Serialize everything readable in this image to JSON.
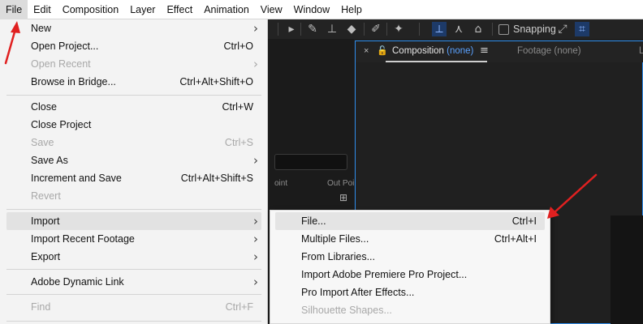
{
  "menubar": {
    "items": [
      "File",
      "Edit",
      "Composition",
      "Layer",
      "Effect",
      "Animation",
      "View",
      "Window",
      "Help"
    ]
  },
  "file_menu": {
    "items": [
      {
        "label": "New",
        "shortcut": "",
        "submenu": true,
        "disabled": false
      },
      {
        "label": "Open Project...",
        "shortcut": "Ctrl+O",
        "submenu": false,
        "disabled": false
      },
      {
        "label": "Open Recent",
        "shortcut": "",
        "submenu": true,
        "disabled": true
      },
      {
        "label": "Browse in Bridge...",
        "shortcut": "Ctrl+Alt+Shift+O",
        "submenu": false,
        "disabled": false
      },
      {
        "label": "Close",
        "shortcut": "Ctrl+W",
        "submenu": false,
        "disabled": false
      },
      {
        "label": "Close Project",
        "shortcut": "",
        "submenu": false,
        "disabled": false
      },
      {
        "label": "Save",
        "shortcut": "Ctrl+S",
        "submenu": false,
        "disabled": true
      },
      {
        "label": "Save As",
        "shortcut": "",
        "submenu": true,
        "disabled": false
      },
      {
        "label": "Increment and Save",
        "shortcut": "Ctrl+Alt+Shift+S",
        "submenu": false,
        "disabled": false
      },
      {
        "label": "Revert",
        "shortcut": "",
        "submenu": false,
        "disabled": true
      },
      {
        "label": "Import",
        "shortcut": "",
        "submenu": true,
        "disabled": false
      },
      {
        "label": "Import Recent Footage",
        "shortcut": "",
        "submenu": true,
        "disabled": false
      },
      {
        "label": "Export",
        "shortcut": "",
        "submenu": true,
        "disabled": false
      },
      {
        "label": "Adobe Dynamic Link",
        "shortcut": "",
        "submenu": true,
        "disabled": false
      },
      {
        "label": "Find",
        "shortcut": "Ctrl+F",
        "submenu": false,
        "disabled": true
      }
    ]
  },
  "import_submenu": {
    "items": [
      {
        "label": "File...",
        "shortcut": "Ctrl+I",
        "disabled": false
      },
      {
        "label": "Multiple Files...",
        "shortcut": "Ctrl+Alt+I",
        "disabled": false
      },
      {
        "label": "From Libraries...",
        "shortcut": "",
        "disabled": false
      },
      {
        "label": "Import Adobe Premiere Pro Project...",
        "shortcut": "",
        "disabled": false
      },
      {
        "label": "Pro Import After Effects...",
        "shortcut": "",
        "disabled": false
      },
      {
        "label": "Silhouette Shapes...",
        "shortcut": "",
        "disabled": true
      }
    ]
  },
  "toolbar": {
    "snapping_label": "Snapping"
  },
  "project_panel": {
    "col_point": "oint",
    "col_out": "Out Poi"
  },
  "comp_panel": {
    "tab_composition": "Composition",
    "tab_composition_value": "(none)",
    "tab_footage": "Footage (none)",
    "tab_extra": "L"
  },
  "colors": {
    "accent_blue": "#2d8ceb",
    "annotation_red": "#e02020",
    "highlight_bg": "#dcdcdc"
  },
  "icons": {
    "arrow": "chevron-right-icon",
    "lock": "lock-icon",
    "menu": "hamburger-icon"
  }
}
